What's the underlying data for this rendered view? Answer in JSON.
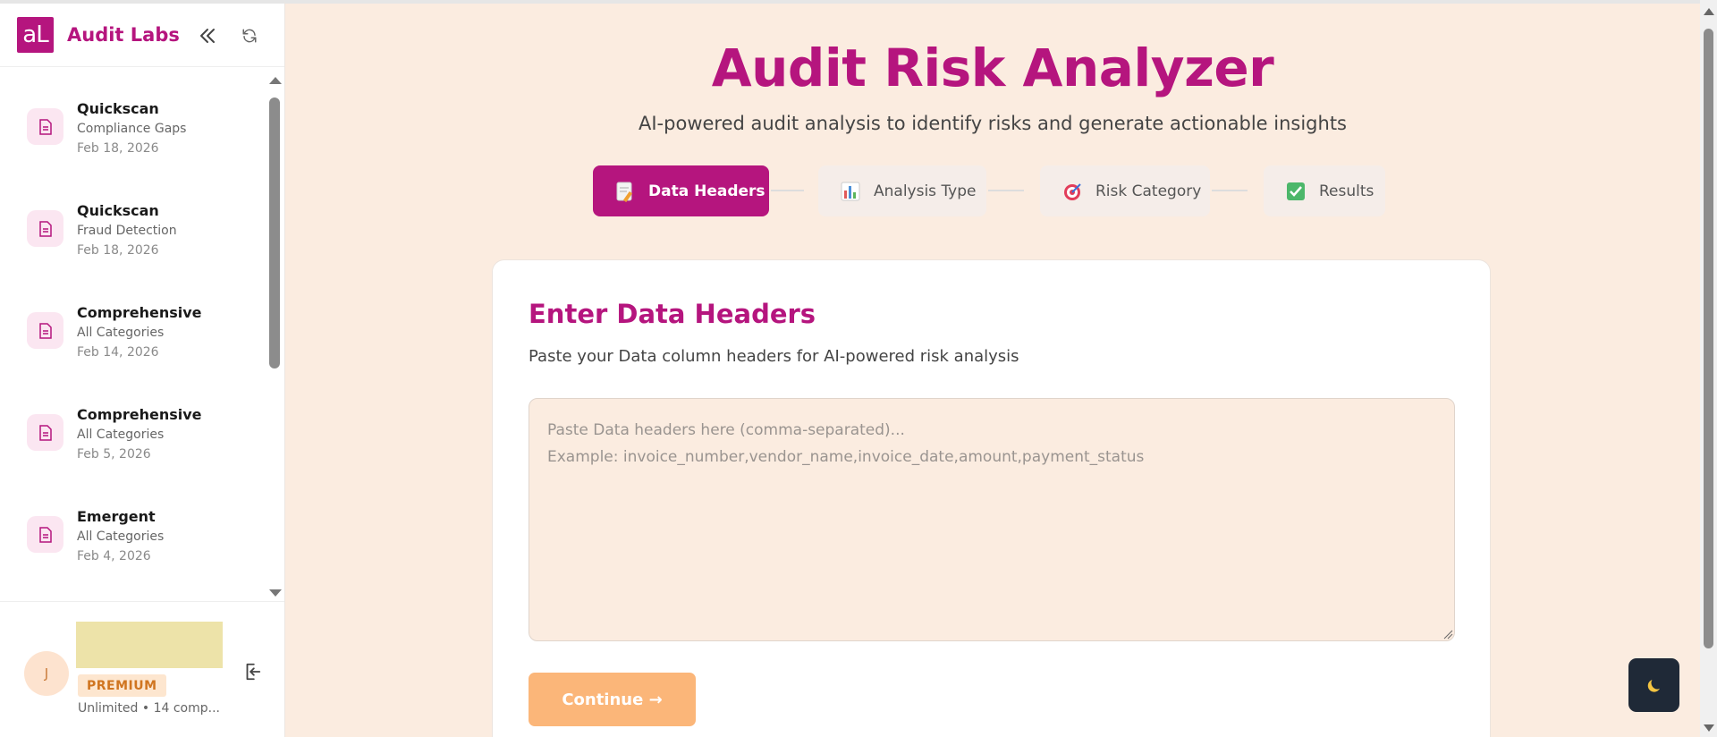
{
  "sidebar": {
    "brand": {
      "logo_text": "aL",
      "name": "Audit Labs"
    },
    "header_icons": {
      "collapse": "double-chevron-left-icon",
      "refresh": "refresh-icon"
    },
    "history": [
      {
        "title": "Quickscan",
        "subtitle": "Compliance Gaps",
        "date": "Feb 18, 2026"
      },
      {
        "title": "Quickscan",
        "subtitle": "Fraud Detection",
        "date": "Feb 18, 2026"
      },
      {
        "title": "Comprehensive",
        "subtitle": "All Categories",
        "date": "Feb 14, 2026"
      },
      {
        "title": "Comprehensive",
        "subtitle": "All Categories",
        "date": "Feb 5, 2026"
      },
      {
        "title": "Emergent",
        "subtitle": "All Categories",
        "date": "Feb 4, 2026"
      }
    ],
    "user": {
      "avatar_initial": "J",
      "plan_badge": "PREMIUM",
      "usage": "Unlimited • 14 comp..."
    }
  },
  "main": {
    "title": "Audit Risk Analyzer",
    "subtitle": "AI-powered audit analysis to identify risks and generate actionable insights",
    "steps": [
      {
        "label": "Data Headers",
        "icon": "memo-icon",
        "active": true
      },
      {
        "label": "Analysis Type",
        "icon": "bar-chart-icon",
        "active": false
      },
      {
        "label": "Risk Category",
        "icon": "target-icon",
        "active": false
      },
      {
        "label": "Results",
        "icon": "check-box-icon",
        "active": false
      }
    ],
    "card": {
      "title": "Enter Data Headers",
      "description": "Paste your Data column headers for AI-powered risk analysis",
      "input_value": "",
      "input_placeholder": "Paste Data headers here (comma-separated)...\nExample: invoice_number,vendor_name,invoice_date,amount,payment_status",
      "continue_label": "Continue →"
    },
    "theme_toggle_icon": "moon-icon"
  },
  "colors": {
    "brand": "#b5157e",
    "page_bg": "#fbece0",
    "continue_btn": "#fbb679",
    "premium_text": "#d07520",
    "theme_btn": "#1f2937"
  }
}
